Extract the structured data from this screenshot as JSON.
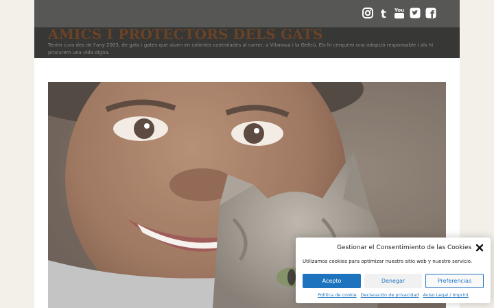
{
  "header": {
    "site_title": "AMICS I PROTECTORS DELS GATS",
    "tagline": "Tenim cura des de l'any 2003, de gats i gates que viuen en colònies controlades al carrer, a Vilanova i la Geltrú. Els hi cerquem una adopció responsable i als hi procurem una vida digna.",
    "social_icons": [
      "instagram-icon",
      "tumblr-icon",
      "youtube-icon",
      "twitter-icon",
      "facebook-icon"
    ]
  },
  "social": {
    "tumblr_glyph": "t",
    "youtube_glyph": "You",
    "facebook_glyph": "f"
  },
  "cookie_banner": {
    "title": "Gestionar el Consentimiento de las Cookies",
    "text": "Utilizamos cookies para optimizar nuestro sitio web y nuestro servicio.",
    "accept_label": "Acepto",
    "deny_label": "Denegar",
    "preferences_label": "Preferencias",
    "links": {
      "cookie_policy": "Política de cookie",
      "privacy": "Declaración de privacidad",
      "legal": "Aviso Legal / Imprint"
    }
  },
  "colors": {
    "accent": "#1e73be",
    "title": "#6a4327",
    "topbar": "#575755",
    "titlebar": "#373736"
  }
}
